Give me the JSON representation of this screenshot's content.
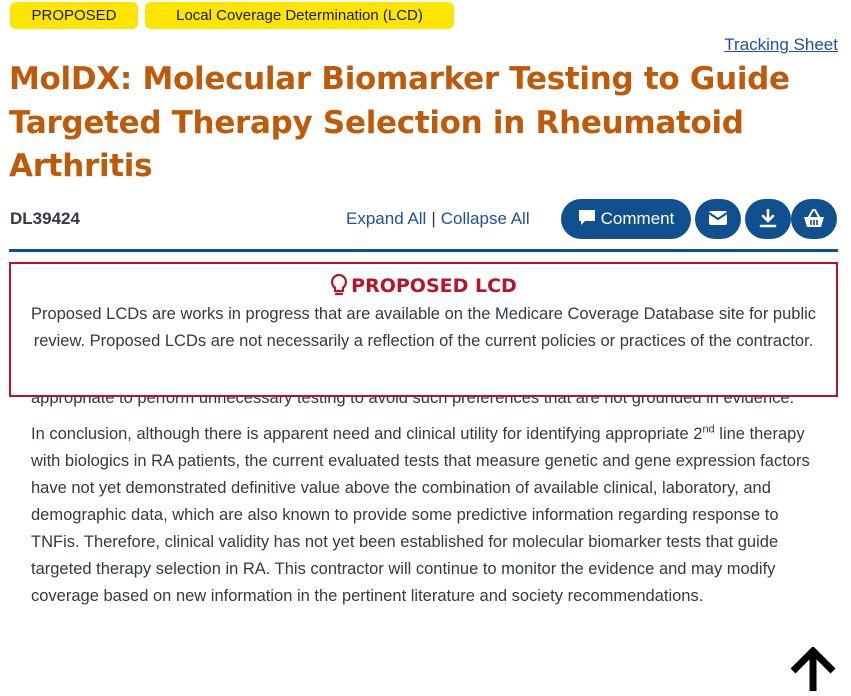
{
  "badges": {
    "status": "PROPOSED",
    "type": "Local Coverage Determination (LCD)"
  },
  "tracking_link": "Tracking Sheet",
  "title": "MolDX: Molecular Biomarker Testing to Guide Targeted Therapy Selection in Rheumatoid Arthritis",
  "doc_id": "DL39424",
  "toolbar": {
    "expand_all": "Expand All",
    "separator": "|",
    "collapse_all": "Collapse All",
    "comment_label": "Comment",
    "email_icon": "envelope-icon",
    "download_icon": "download-icon",
    "basket_icon": "basket-icon"
  },
  "notice": {
    "title": "PROPOSED LCD",
    "icon": "lightbulb-icon",
    "text": "Proposed LCDs are works in progress that are available on the Medicare Coverage Database site for public review. Proposed LCDs are not necessarily a reflection of the current policies or practices of the contractor."
  },
  "content": {
    "para1": "appropriate to perform unnecessary testing to avoid such preferences that are not grounded in evidence.",
    "para2_a": "In conclusion, although there is apparent need and clinical utility for identifying appropriate 2",
    "para2_sup": "nd",
    "para2_b": " line therapy with biologics in RA patients, the current evaluated tests that measure genetic and gene expression factors have not yet demonstrated definitive value above the combination of available clinical, laboratory, and demographic data, which are also known to provide some predictive information regarding response to TNFis. Therefore, clinical validity has not yet been established for molecular biomarker tests that guide targeted therapy selection in RA. This contractor will continue to monitor the evidence and may modify coverage based on new information in the pertinent literature and society recommendations."
  },
  "colors": {
    "title": "#bf5a08",
    "badge": "#fde500",
    "primary": "#11508e",
    "alert": "#b5142a",
    "link": "#1f4fa0"
  },
  "scroll_top_icon": "arrow-up-icon"
}
